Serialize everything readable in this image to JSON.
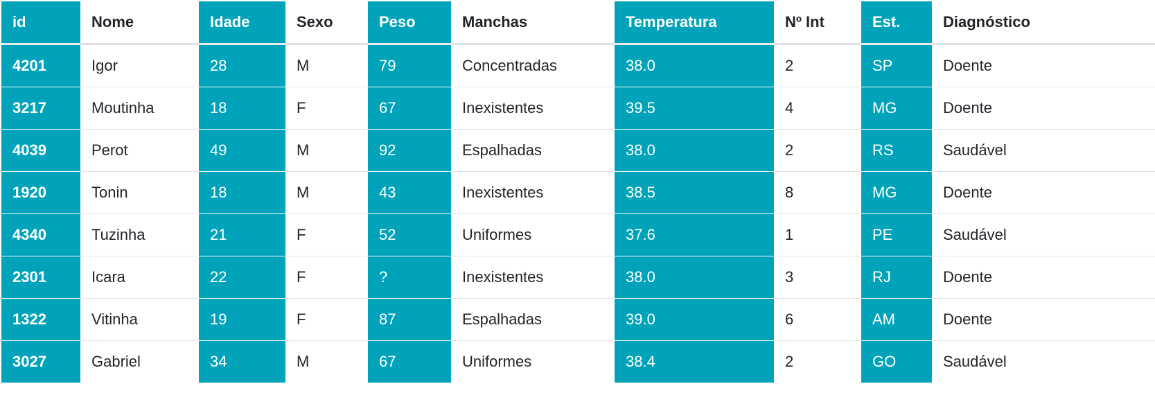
{
  "table": {
    "headers": [
      "id",
      "Nome",
      "Idade",
      "Sexo",
      "Peso",
      "Manchas",
      "Temperatura",
      "Nº Int",
      "Est.",
      "Diagnóstico"
    ],
    "rows": [
      [
        "4201",
        "Igor",
        "28",
        "M",
        "79",
        "Concentradas",
        "38.0",
        "2",
        "SP",
        "Doente"
      ],
      [
        "3217",
        "Moutinha",
        "18",
        "F",
        "67",
        "Inexistentes",
        "39.5",
        "4",
        "MG",
        "Doente"
      ],
      [
        "4039",
        "Perot",
        "49",
        "M",
        "92",
        "Espalhadas",
        "38.0",
        "2",
        "RS",
        "Saudável"
      ],
      [
        "1920",
        "Tonin",
        "18",
        "M",
        "43",
        "Inexistentes",
        "38.5",
        "8",
        "MG",
        "Doente"
      ],
      [
        "4340",
        "Tuzinha",
        "21",
        "F",
        "52",
        "Uniformes",
        "37.6",
        "1",
        "PE",
        "Saudável"
      ],
      [
        "2301",
        "Icara",
        "22",
        "F",
        "?",
        "Inexistentes",
        "38.0",
        "3",
        "RJ",
        "Doente"
      ],
      [
        "1322",
        "Vitinha",
        "19",
        "F",
        "87",
        "Espalhadas",
        "39.0",
        "6",
        "AM",
        "Doente"
      ],
      [
        "3027",
        "Gabriel",
        "34",
        "M",
        "67",
        "Uniformes",
        "38.4",
        "2",
        "GO",
        "Saudável"
      ]
    ]
  },
  "colors": {
    "accent": "#00a3b9",
    "text": "#212529",
    "border": "#dee2e6"
  }
}
